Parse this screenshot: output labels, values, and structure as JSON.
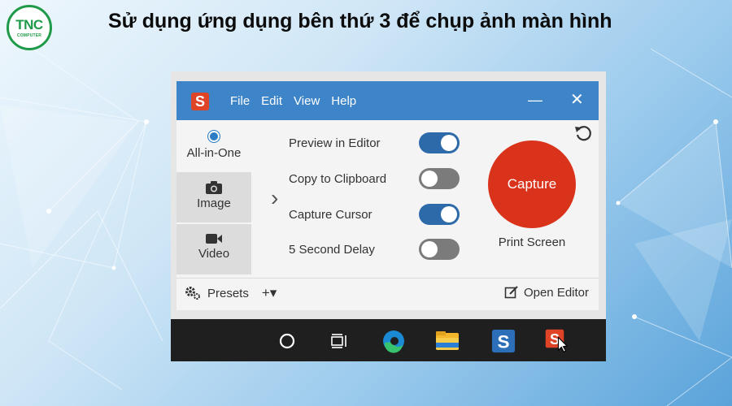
{
  "page": {
    "headline": "Sử dụng ứng dụng bên thứ 3 để chụp ảnh màn hình",
    "logo": {
      "text": "TNC",
      "subtext": "COMPUTER"
    }
  },
  "app": {
    "logo_letter": "S",
    "menu": [
      "File",
      "Edit",
      "View",
      "Help"
    ],
    "controls": {
      "minimize": "—",
      "close": "✕"
    },
    "modes": [
      {
        "label": "All-in-One",
        "icon": "radio-icon",
        "selected": true
      },
      {
        "label": "Image",
        "icon": "camera-icon",
        "selected": false
      },
      {
        "label": "Video",
        "icon": "video-camera-icon",
        "selected": false
      }
    ],
    "options": [
      {
        "label": "Preview in Editor",
        "on": true
      },
      {
        "label": "Copy to Clipboard",
        "on": false
      },
      {
        "label": "Capture Cursor",
        "on": true
      },
      {
        "label": "5 Second Delay",
        "on": false
      }
    ],
    "capture": {
      "label": "Capture",
      "hotkey": "Print Screen"
    },
    "bottom": {
      "presets_label": "Presets",
      "add_label": "+▾",
      "open_editor_label": "Open Editor"
    }
  },
  "taskbar": {
    "icons": [
      "search-circle-icon",
      "task-view-icon",
      "edge-icon",
      "file-explorer-icon",
      "snagit-editor-icon",
      "snagit-capture-icon"
    ]
  },
  "colors": {
    "titlebar": "#3d84c8",
    "capture": "#d9331c",
    "toggle_on": "#2d6aaa",
    "toggle_off": "#7b7b7b",
    "logo_green": "#1e9a48"
  }
}
